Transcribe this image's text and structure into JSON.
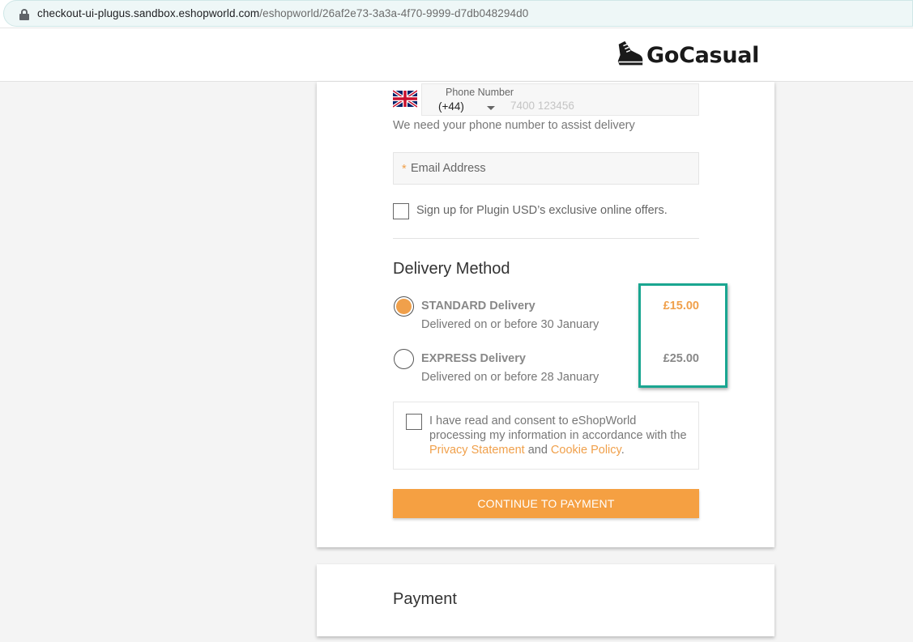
{
  "browser": {
    "url_host": "checkout-ui-plugus.sandbox.eshopworld.com",
    "url_path": "/eshopworld/26af2e73-3a3a-4f70-9999-d7db048294d0"
  },
  "header": {
    "brand_name": "GoCasual",
    "brand_icon": "sneaker-icon"
  },
  "contact": {
    "phone_label": "Phone Number",
    "phone_code": "(+44)",
    "phone_placeholder": "7400 123456",
    "phone_flag": "uk-flag-icon",
    "phone_hint": "We need your phone number to assist delivery",
    "email_required_mark": "*",
    "email_placeholder": "Email Address",
    "newsletter_label": "Sign up for Plugin USD’s exclusive online offers."
  },
  "delivery": {
    "title": "Delivery Method",
    "options": [
      {
        "name": "STANDARD Delivery",
        "date": "Delivered on or before 30 January",
        "price": "£15.00",
        "selected": true
      },
      {
        "name": "EXPRESS Delivery",
        "date": "Delivered on or before 28 January",
        "price": "£25.00",
        "selected": false
      }
    ]
  },
  "consent": {
    "text_1": "I have read and consent to eShopWorld processing my information in accordance with the ",
    "privacy_link": "Privacy Statement",
    "text_2": " and ",
    "cookie_link": "Cookie Policy",
    "text_3": "."
  },
  "cta_label": "CONTINUE TO PAYMENT",
  "payment": {
    "title": "Payment"
  },
  "colors": {
    "accent": "#f5a042",
    "highlight_border": "#1aa691"
  }
}
